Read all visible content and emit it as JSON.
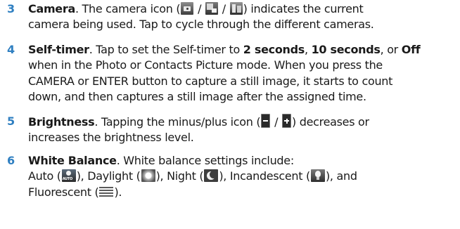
{
  "items": [
    {
      "number": "3",
      "lines": [
        {
          "title": "Camera",
          "text_a": ". The camera icon (",
          "sep1": " / ",
          "sep2": " / ",
          "text_b": ") indicates the current"
        },
        {
          "text": "camera being used. Tap to cycle through the different cameras."
        }
      ],
      "icons": [
        "camera-icon",
        "camera-secondary-icon",
        "camera-video-icon"
      ]
    },
    {
      "number": "4",
      "lines": [
        {
          "title": "Self-timer",
          "text_a": ". Tap to set the Self-timer to ",
          "opt1": "2 seconds",
          "c1": ", ",
          "opt2": "10 seconds",
          "c2": ", or ",
          "opt3": "Off"
        },
        {
          "text": "when in the Photo or Contacts Picture mode. When you press the"
        },
        {
          "text": "CAMERA or ENTER button to capture a still image, it starts to count"
        },
        {
          "text": "down, and then captures a still image after the assigned time."
        }
      ]
    },
    {
      "number": "5",
      "lines": [
        {
          "title": "Brightness",
          "text_a": ". Tapping the minus/plus icon (",
          "sep1": " / ",
          "text_b": ") decreases or"
        },
        {
          "text": "increases the brightness level."
        }
      ],
      "icons": [
        "minus-icon",
        "plus-icon"
      ]
    },
    {
      "number": "6",
      "lines": [
        {
          "title": "White Balance",
          "text_a": ". White balance settings include:"
        },
        {
          "a": "Auto (",
          "b": "), Daylight (",
          "c": "), Night (",
          "d": "), Incandescent (",
          "e": "), and"
        },
        {
          "a": "Fluorescent (",
          "b": ")."
        }
      ],
      "icons": [
        "auto-wb-icon",
        "daylight-icon",
        "night-icon",
        "incandescent-icon",
        "fluorescent-icon"
      ]
    }
  ]
}
